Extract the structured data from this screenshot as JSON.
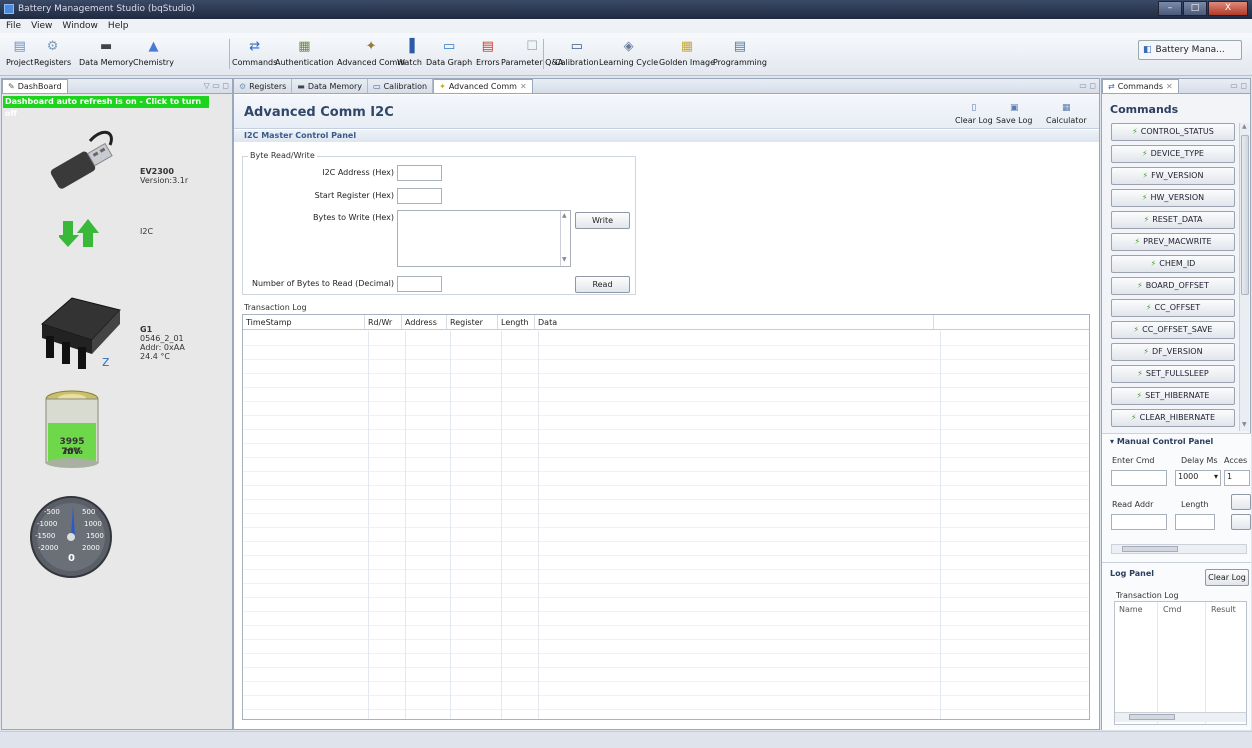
{
  "window": {
    "title": "Battery Management Studio (bqStudio)",
    "controls": [
      "–",
      "□",
      "X"
    ]
  },
  "menu": [
    "File",
    "View",
    "Window",
    "Help"
  ],
  "toolbar": {
    "left": [
      {
        "label": "Project",
        "icon": "project-icon",
        "glyph": "▤",
        "color": "#6a8fc8"
      },
      {
        "label": "Registers",
        "icon": "registers-icon",
        "glyph": "⚙",
        "color": "#7a9bb8"
      },
      {
        "label": "Data Memory",
        "icon": "data-memory-icon",
        "glyph": "▬",
        "color": "#444"
      },
      {
        "label": "Chemistry",
        "icon": "chemistry-icon",
        "glyph": "▲",
        "color": "#4a7ad8"
      }
    ],
    "right": [
      {
        "label": "Commands",
        "icon": "commands-icon",
        "glyph": "⇄",
        "color": "#2a6ac8"
      },
      {
        "label": "Authentication",
        "icon": "authentication-icon",
        "glyph": "▦",
        "color": "#6a8a3a"
      },
      {
        "label": "Advanced Comm",
        "icon": "advanced-comm-icon",
        "glyph": "✦",
        "color": "#9a7a3a"
      },
      {
        "label": "Watch",
        "icon": "watch-icon",
        "glyph": "▐",
        "color": "#2a5aa8"
      },
      {
        "label": "Data Graph",
        "icon": "data-graph-icon",
        "glyph": "▭",
        "color": "#2a7ac8"
      },
      {
        "label": "Errors",
        "icon": "errors-icon",
        "glyph": "▤",
        "color": "#c83a2a"
      },
      {
        "label": "Parameter Q&A",
        "icon": "parameter-qa-icon",
        "glyph": "☐",
        "color": "#9aa"
      },
      {
        "label": "Calibration",
        "icon": "calibration-icon",
        "glyph": "▭",
        "color": "#3a5a88"
      },
      {
        "label": "Learning Cycle",
        "icon": "learning-cycle-icon",
        "glyph": "◈",
        "color": "#6a7a9a"
      },
      {
        "label": "Golden Image",
        "icon": "golden-image-icon",
        "glyph": "▦",
        "color": "#c8a83a"
      },
      {
        "label": "Programming",
        "icon": "programming-icon",
        "glyph": "▤",
        "color": "#5a7a9a"
      }
    ],
    "perspective": "Battery Mana..."
  },
  "dashboard": {
    "tab": "DashBoard",
    "refresh": "Dashboard auto refresh is on - Click to turn off",
    "adapter_name": "EV2300",
    "adapter_version": "Version:3.1r",
    "bus": "I2C",
    "gauge_name": "G1",
    "gauge_id": "0546_2_01",
    "gauge_addr": "Addr: 0xAA",
    "gauge_temp": "24.4 °C",
    "battery_mv": "3995 mV",
    "battery_pct": "70%",
    "current_value": "0",
    "dial_labels": [
      "-500",
      "500",
      "-1000",
      "1000",
      "-1500",
      "1500",
      "-2000",
      "2000"
    ]
  },
  "editor": {
    "tabs": [
      "Registers",
      "Data Memory",
      "Calibration",
      "Advanced Comm"
    ],
    "title": "Advanced Comm I2C",
    "actions": [
      "Clear Log",
      "Save Log",
      "Calculator"
    ],
    "section": "I2C Master Control Panel",
    "group": "Byte Read/Write",
    "fields": {
      "address": "I2C Address (Hex)",
      "start_reg": "Start Register (Hex)",
      "bytes_write": "Bytes to Write (Hex)",
      "bytes_read": "Number of Bytes to Read (Decimal)"
    },
    "write_btn": "Write",
    "read_btn": "Read",
    "log_label": "Transaction Log",
    "columns": [
      "TimeStamp",
      "Rd/Wr",
      "Address",
      "Register",
      "Length",
      "Data"
    ]
  },
  "commands": {
    "tab": "Commands",
    "title": "Commands",
    "items": [
      "CONTROL_STATUS",
      "DEVICE_TYPE",
      "FW_VERSION",
      "HW_VERSION",
      "RESET_DATA",
      "PREV_MACWRITE",
      "CHEM_ID",
      "BOARD_OFFSET",
      "CC_OFFSET",
      "CC_OFFSET_SAVE",
      "DF_VERSION",
      "SET_FULLSLEEP",
      "SET_HIBERNATE",
      "CLEAR_HIBERNATE"
    ],
    "manual": {
      "title": "Manual Control Panel",
      "enter_cmd": "Enter Cmd",
      "delay_ms": "Delay Ms",
      "access": "Acces",
      "delay_value": "1000",
      "access_value": "1",
      "read_addr": "Read Addr",
      "length": "Length"
    },
    "log": {
      "title": "Log Panel",
      "clear": "Clear Log",
      "group": "Transaction Log",
      "columns": [
        "Name",
        "Cmd",
        "Result"
      ]
    }
  }
}
